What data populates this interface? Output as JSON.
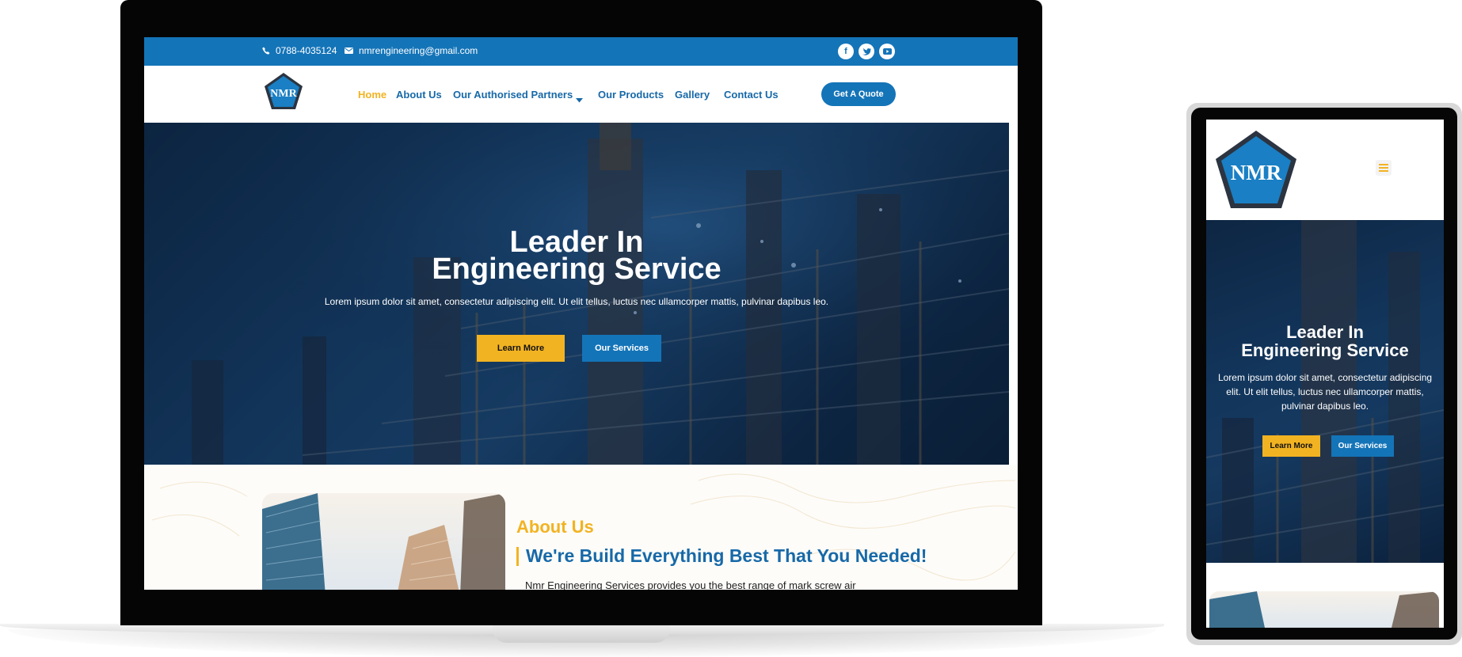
{
  "topbar": {
    "phone": "0788-4035124",
    "email": "nmrengineering@gmail.com",
    "social": [
      "facebook-icon",
      "twitter-icon",
      "youtube-icon"
    ]
  },
  "brand": {
    "logo_text": "NMR"
  },
  "nav": {
    "items": [
      "Home",
      "About Us",
      "Our Authorised Partners",
      "Our Products",
      "Gallery",
      "Contact Us"
    ],
    "cta": "Get A Quote"
  },
  "hero": {
    "title_line1": "Leader In",
    "title_line2": "Engineering Service",
    "subtitle": "Lorem ipsum dolor sit amet, consectetur adipiscing elit. Ut elit tellus, luctus nec ullamcorper mattis, pulvinar dapibus leo.",
    "btn_primary": "Learn More",
    "btn_secondary": "Our Services"
  },
  "about": {
    "label": "About Us",
    "heading": "We're Build Everything Best That You Needed!",
    "text": "Nmr Engineering Services provides you the best range of mark screw air"
  },
  "mobile": {
    "title_line1": "Leader In",
    "title_line2": "Engineering Service",
    "subtitle": "Lorem ipsum dolor sit amet, consectetur adipiscing elit. Ut elit tellus, luctus nec ullamcorper mattis, pulvinar dapibus leo.",
    "btn_primary": "Learn More",
    "btn_secondary": "Our Services"
  },
  "colors": {
    "brand_blue": "#1474b8",
    "accent_yellow": "#f2b322",
    "hero_dark": "#0d2744"
  }
}
